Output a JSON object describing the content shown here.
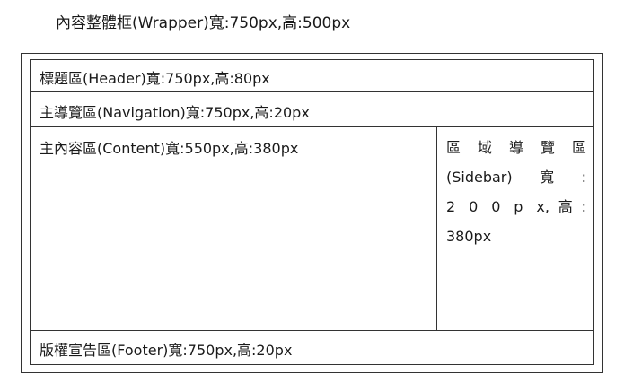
{
  "wrapper": {
    "label": "內容整體框(Wrapper)寬:750px,高:500px"
  },
  "header": {
    "label": "標題區(Header)寬:750px,高:80px"
  },
  "navigation": {
    "label": "主導覽區(Navigation)寬:750px,高:20px"
  },
  "content": {
    "label": "主內容區(Content)寬:550px,高:380px"
  },
  "sidebar": {
    "lines": [
      "區 域 導 覽 區",
      "(Sidebar)寬:",
      "2 0 0 p x,高:",
      "380px"
    ]
  },
  "footer": {
    "label": "版權宣告區(Footer)寬:750px,高:20px"
  }
}
